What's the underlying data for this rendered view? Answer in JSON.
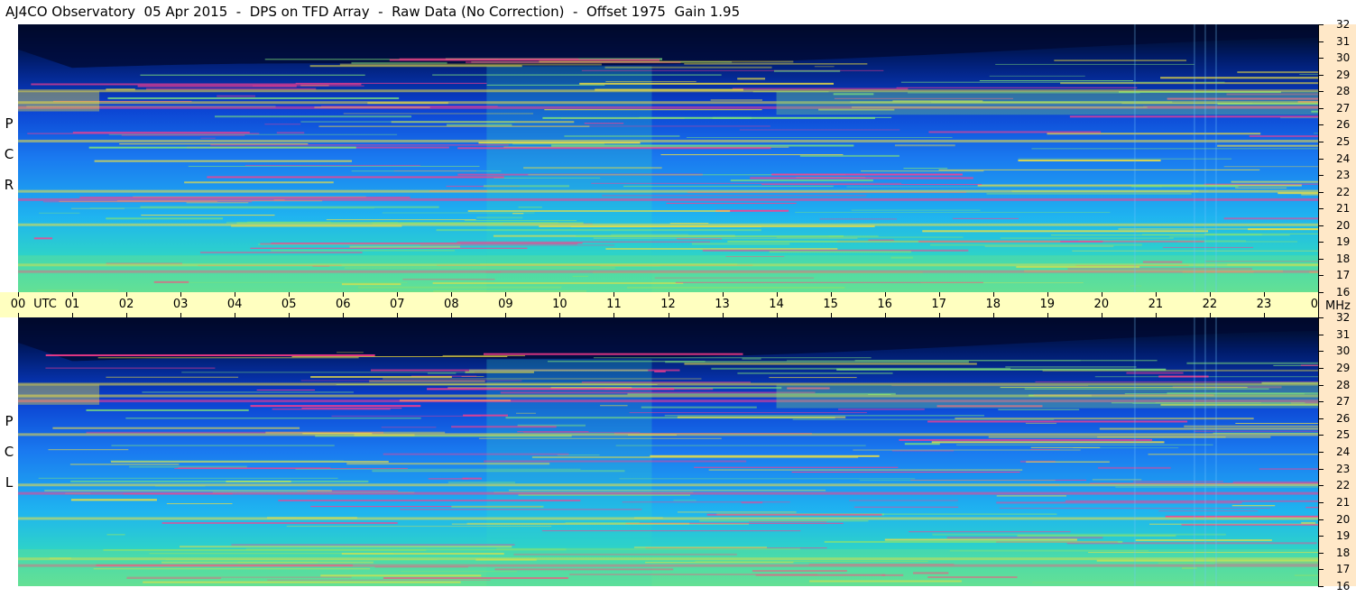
{
  "title": "AJ4CO Observatory  05 Apr 2015  -  DPS on TFD Array  -  Raw Data (No Correction)  -  Offset 1975  Gain 1.95",
  "panels": [
    {
      "id": "rcp",
      "letters": [
        "R",
        "C",
        "P"
      ]
    },
    {
      "id": "lcp",
      "letters": [
        "L",
        "C",
        "P"
      ]
    }
  ],
  "chart_data": {
    "type": "heatmap",
    "title": "AJ4CO Observatory  05 Apr 2015  -  DPS on TFD Array  -  Raw Data (No Correction)  -  Offset 1975  Gain 1.95",
    "x_unit": "UTC",
    "y_unit": "MHz",
    "x_ticks": [
      "00",
      "01",
      "02",
      "03",
      "04",
      "05",
      "06",
      "07",
      "08",
      "09",
      "10",
      "11",
      "12",
      "13",
      "14",
      "15",
      "16",
      "17",
      "18",
      "19",
      "20",
      "21",
      "22",
      "23",
      "00"
    ],
    "y_ticks": [
      16,
      17,
      18,
      19,
      20,
      21,
      22,
      23,
      24,
      25,
      26,
      27,
      28,
      29,
      30,
      31,
      32
    ],
    "xlim": [
      0,
      24
    ],
    "ylim": [
      16,
      32
    ],
    "series": [
      {
        "name": "R C P"
      },
      {
        "name": "L C P"
      }
    ],
    "bright_bands_mhz": [
      17.2,
      17.6,
      20.0,
      21.5,
      22.0,
      25.0,
      27.0,
      27.3,
      28.0
    ],
    "colormap": [
      "#000814",
      "#001a66",
      "#0a3fd0",
      "#1a7af0",
      "#1fb4f0",
      "#2fd6c4",
      "#7ee07a",
      "#f0e040",
      "#ff3c8c"
    ]
  },
  "labels": {
    "utc": "UTC",
    "mhz": "MHz"
  }
}
